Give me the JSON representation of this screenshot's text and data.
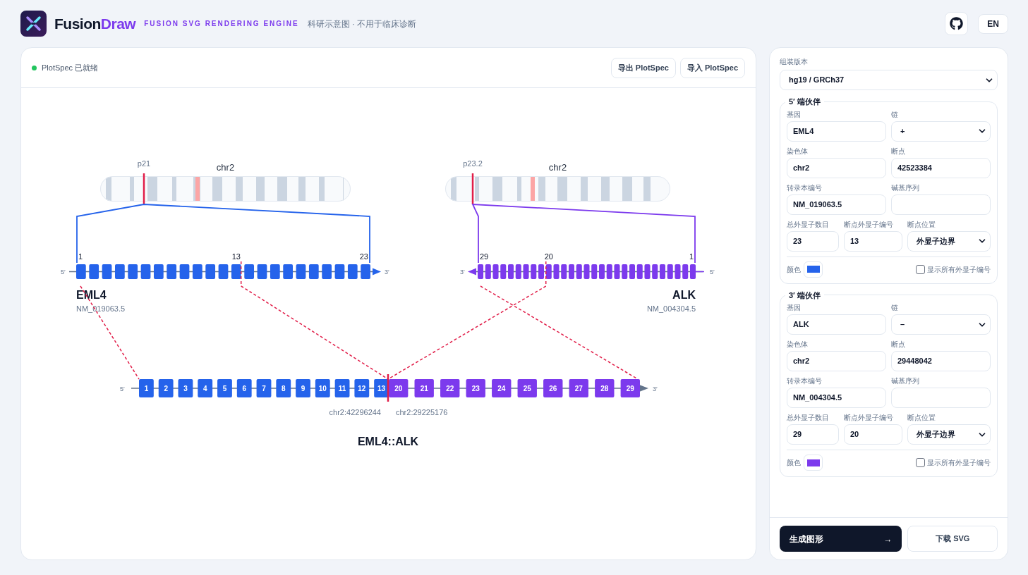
{
  "header": {
    "brand": "Fusion",
    "brand_accent": "Draw",
    "tagline": "FUSION SVG RENDERING ENGINE",
    "note": "科研示意图 · 不用于临床诊断",
    "language_button": "EN"
  },
  "canvas": {
    "status": "PlotSpec 已就绪",
    "buttons": [
      "导出 PlotSpec",
      "导入 PlotSpec"
    ],
    "partners": [
      {
        "band": "p21",
        "chromosome": "chr2",
        "kind": "forward",
        "exon_labels": [
          {
            "text": "1",
            "kind": "first"
          },
          {
            "text": "13",
            "kind": "breakpoint"
          },
          {
            "text": "23",
            "kind": "last"
          }
        ],
        "end_labels": [
          "5′",
          "3′"
        ],
        "gene": "EML4",
        "transcript": "NM_019063.5"
      },
      {
        "band": "p23.2",
        "chromosome": "chr2",
        "kind": "reverse",
        "exon_labels": [
          {
            "text": "29",
            "kind": "last"
          },
          {
            "text": "20",
            "kind": "breakpoint"
          },
          {
            "text": "1",
            "kind": "first"
          }
        ],
        "end_labels": [
          "3′",
          "5′"
        ],
        "gene": "ALK",
        "transcript": "NM_004304.5"
      }
    ],
    "fusion": {
      "end_labels": [
        "5′",
        "3′"
      ],
      "exons": [
        {
          "label": "1",
          "kind": "five_prime"
        },
        {
          "label": "2",
          "kind": "five_prime"
        },
        {
          "label": "3",
          "kind": "five_prime"
        },
        {
          "label": "4",
          "kind": "five_prime"
        },
        {
          "label": "5",
          "kind": "five_prime"
        },
        {
          "label": "6",
          "kind": "five_prime"
        },
        {
          "label": "7",
          "kind": "five_prime"
        },
        {
          "label": "8",
          "kind": "five_prime"
        },
        {
          "label": "9",
          "kind": "five_prime"
        },
        {
          "label": "10",
          "kind": "five_prime"
        },
        {
          "label": "11",
          "kind": "five_prime"
        },
        {
          "label": "12",
          "kind": "five_prime"
        },
        {
          "label": "13",
          "kind": "five_prime"
        },
        {
          "label": "20",
          "kind": "three_prime"
        },
        {
          "label": "21",
          "kind": "three_prime"
        },
        {
          "label": "22",
          "kind": "three_prime"
        },
        {
          "label": "23",
          "kind": "three_prime"
        },
        {
          "label": "24",
          "kind": "three_prime"
        },
        {
          "label": "25",
          "kind": "three_prime"
        },
        {
          "label": "26",
          "kind": "three_prime"
        },
        {
          "label": "27",
          "kind": "three_prime"
        },
        {
          "label": "28",
          "kind": "three_prime"
        },
        {
          "label": "29",
          "kind": "three_prime"
        }
      ],
      "coordinates": [
        "chr2:42296244",
        "chr2:29225176"
      ],
      "title": "EML4::ALK"
    }
  },
  "sidebar": {
    "assembly_label": "组装版本",
    "assembly": "hg19 / GRCh37",
    "partners": [
      {
        "title": "5′ 端伙伴",
        "color": "#2563eb",
        "gene_label": "基因",
        "gene": "EML4",
        "strand_label": "链",
        "strand": "+",
        "chromosome_label": "染色体",
        "chromosome": "chr2",
        "breakpoint_label": "断点",
        "breakpoint": "42523384",
        "transcript_label": "转录本编号",
        "transcript": "NM_019063.5",
        "sequence_label": "碱基序列",
        "total_exons_label": "总外显子数目",
        "total_exons": "23",
        "breakpoint_exon_label": "断点外显子编号",
        "breakpoint_exon": "13",
        "position_label": "断点位置",
        "position": "外显子边界",
        "color_label": "颜色",
        "show_all_label": "显示所有外显子编号",
        "show_all": false
      },
      {
        "title": "3′ 端伙伴",
        "color": "#7c3aed",
        "gene_label": "基因",
        "gene": "ALK",
        "strand_label": "链",
        "strand": "–",
        "chromosome_label": "染色体",
        "chromosome": "chr2",
        "breakpoint_label": "断点",
        "breakpoint": "29448042",
        "transcript_label": "转录本编号",
        "transcript": "NM_004304.5",
        "sequence_label": "碱基序列",
        "total_exons_label": "总外显子数目",
        "total_exons": "29",
        "breakpoint_exon_label": "断点外显子编号",
        "breakpoint_exon": "20",
        "position_label": "断点位置",
        "position": "外显子边界",
        "color_label": "颜色",
        "show_all_label": "显示所有外显子编号",
        "show_all": false
      }
    ],
    "generate_button": "生成图形",
    "generate_arrow": "→",
    "download_button": "下载 SVG"
  }
}
